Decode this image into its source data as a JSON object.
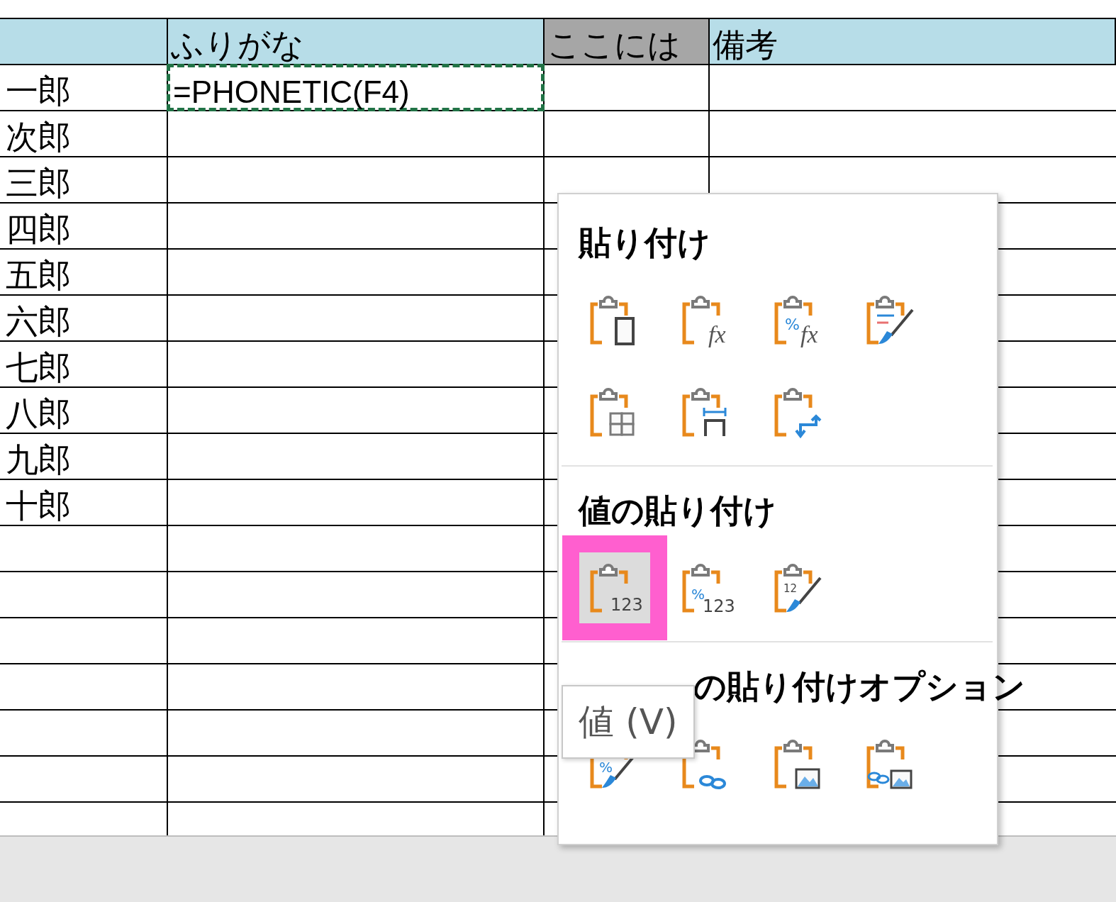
{
  "columns": [
    {
      "label": "ふりがな",
      "shaded": false
    },
    {
      "label": "ここには",
      "shaded": true
    },
    {
      "label": "備考",
      "shaded": false
    }
  ],
  "rows": [
    {
      "name": "一郎",
      "furigana": {
        "text": "=PHONETIC(F4)",
        "copied": true
      }
    },
    {
      "name": "次郎"
    },
    {
      "name": "三郎"
    },
    {
      "name": "四郎"
    },
    {
      "name": "五郎"
    },
    {
      "name": "六郎"
    },
    {
      "name": "七郎"
    },
    {
      "name": "八郎"
    },
    {
      "name": "九郎"
    },
    {
      "name": "十郎"
    }
  ],
  "context_menu": {
    "sections": [
      {
        "title": "貼り付け",
        "items": [
          {
            "kind": "paste",
            "selected": false
          },
          {
            "kind": "formulas",
            "icon_texts": [
              "fx"
            ],
            "selected": false
          },
          {
            "kind": "formulas-number-format",
            "icon_texts": [
              "%",
              "fx"
            ],
            "selected": false
          },
          {
            "kind": "keep-source-formatting",
            "selected": false
          },
          {
            "kind": "no-borders",
            "selected": false
          },
          {
            "kind": "keep-column-widths",
            "selected": false
          },
          {
            "kind": "transpose",
            "selected": false
          }
        ]
      },
      {
        "title": "値の貼り付け",
        "items": [
          {
            "kind": "values",
            "icon_texts": [
              "123"
            ],
            "selected": true
          },
          {
            "kind": "values-number-format",
            "icon_texts": [
              "%",
              "123"
            ],
            "selected": false
          },
          {
            "kind": "values-source-formatting",
            "icon_texts": [
              "12"
            ],
            "selected": false
          }
        ]
      },
      {
        "title": "の貼り付けオプション",
        "items": [
          {
            "kind": "formatting",
            "icon_texts": [
              "%"
            ],
            "selected": false
          },
          {
            "kind": "paste-link",
            "selected": false
          },
          {
            "kind": "picture",
            "selected": false
          },
          {
            "kind": "linked-picture",
            "selected": false
          }
        ]
      }
    ],
    "tooltip": "値 (V)"
  }
}
